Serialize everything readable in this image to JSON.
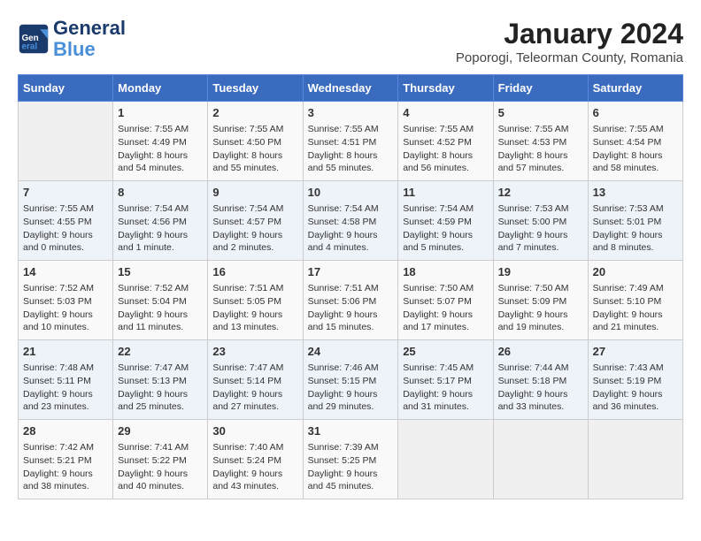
{
  "header": {
    "logo_line1": "General",
    "logo_line2": "Blue",
    "month_year": "January 2024",
    "location": "Poporogi, Teleorman County, Romania"
  },
  "days_of_week": [
    "Sunday",
    "Monday",
    "Tuesday",
    "Wednesday",
    "Thursday",
    "Friday",
    "Saturday"
  ],
  "weeks": [
    [
      {
        "day": "",
        "info": ""
      },
      {
        "day": "1",
        "info": "Sunrise: 7:55 AM\nSunset: 4:49 PM\nDaylight: 8 hours\nand 54 minutes."
      },
      {
        "day": "2",
        "info": "Sunrise: 7:55 AM\nSunset: 4:50 PM\nDaylight: 8 hours\nand 55 minutes."
      },
      {
        "day": "3",
        "info": "Sunrise: 7:55 AM\nSunset: 4:51 PM\nDaylight: 8 hours\nand 55 minutes."
      },
      {
        "day": "4",
        "info": "Sunrise: 7:55 AM\nSunset: 4:52 PM\nDaylight: 8 hours\nand 56 minutes."
      },
      {
        "day": "5",
        "info": "Sunrise: 7:55 AM\nSunset: 4:53 PM\nDaylight: 8 hours\nand 57 minutes."
      },
      {
        "day": "6",
        "info": "Sunrise: 7:55 AM\nSunset: 4:54 PM\nDaylight: 8 hours\nand 58 minutes."
      }
    ],
    [
      {
        "day": "7",
        "info": "Sunrise: 7:55 AM\nSunset: 4:55 PM\nDaylight: 9 hours\nand 0 minutes."
      },
      {
        "day": "8",
        "info": "Sunrise: 7:54 AM\nSunset: 4:56 PM\nDaylight: 9 hours\nand 1 minute."
      },
      {
        "day": "9",
        "info": "Sunrise: 7:54 AM\nSunset: 4:57 PM\nDaylight: 9 hours\nand 2 minutes."
      },
      {
        "day": "10",
        "info": "Sunrise: 7:54 AM\nSunset: 4:58 PM\nDaylight: 9 hours\nand 4 minutes."
      },
      {
        "day": "11",
        "info": "Sunrise: 7:54 AM\nSunset: 4:59 PM\nDaylight: 9 hours\nand 5 minutes."
      },
      {
        "day": "12",
        "info": "Sunrise: 7:53 AM\nSunset: 5:00 PM\nDaylight: 9 hours\nand 7 minutes."
      },
      {
        "day": "13",
        "info": "Sunrise: 7:53 AM\nSunset: 5:01 PM\nDaylight: 9 hours\nand 8 minutes."
      }
    ],
    [
      {
        "day": "14",
        "info": "Sunrise: 7:52 AM\nSunset: 5:03 PM\nDaylight: 9 hours\nand 10 minutes."
      },
      {
        "day": "15",
        "info": "Sunrise: 7:52 AM\nSunset: 5:04 PM\nDaylight: 9 hours\nand 11 minutes."
      },
      {
        "day": "16",
        "info": "Sunrise: 7:51 AM\nSunset: 5:05 PM\nDaylight: 9 hours\nand 13 minutes."
      },
      {
        "day": "17",
        "info": "Sunrise: 7:51 AM\nSunset: 5:06 PM\nDaylight: 9 hours\nand 15 minutes."
      },
      {
        "day": "18",
        "info": "Sunrise: 7:50 AM\nSunset: 5:07 PM\nDaylight: 9 hours\nand 17 minutes."
      },
      {
        "day": "19",
        "info": "Sunrise: 7:50 AM\nSunset: 5:09 PM\nDaylight: 9 hours\nand 19 minutes."
      },
      {
        "day": "20",
        "info": "Sunrise: 7:49 AM\nSunset: 5:10 PM\nDaylight: 9 hours\nand 21 minutes."
      }
    ],
    [
      {
        "day": "21",
        "info": "Sunrise: 7:48 AM\nSunset: 5:11 PM\nDaylight: 9 hours\nand 23 minutes."
      },
      {
        "day": "22",
        "info": "Sunrise: 7:47 AM\nSunset: 5:13 PM\nDaylight: 9 hours\nand 25 minutes."
      },
      {
        "day": "23",
        "info": "Sunrise: 7:47 AM\nSunset: 5:14 PM\nDaylight: 9 hours\nand 27 minutes."
      },
      {
        "day": "24",
        "info": "Sunrise: 7:46 AM\nSunset: 5:15 PM\nDaylight: 9 hours\nand 29 minutes."
      },
      {
        "day": "25",
        "info": "Sunrise: 7:45 AM\nSunset: 5:17 PM\nDaylight: 9 hours\nand 31 minutes."
      },
      {
        "day": "26",
        "info": "Sunrise: 7:44 AM\nSunset: 5:18 PM\nDaylight: 9 hours\nand 33 minutes."
      },
      {
        "day": "27",
        "info": "Sunrise: 7:43 AM\nSunset: 5:19 PM\nDaylight: 9 hours\nand 36 minutes."
      }
    ],
    [
      {
        "day": "28",
        "info": "Sunrise: 7:42 AM\nSunset: 5:21 PM\nDaylight: 9 hours\nand 38 minutes."
      },
      {
        "day": "29",
        "info": "Sunrise: 7:41 AM\nSunset: 5:22 PM\nDaylight: 9 hours\nand 40 minutes."
      },
      {
        "day": "30",
        "info": "Sunrise: 7:40 AM\nSunset: 5:24 PM\nDaylight: 9 hours\nand 43 minutes."
      },
      {
        "day": "31",
        "info": "Sunrise: 7:39 AM\nSunset: 5:25 PM\nDaylight: 9 hours\nand 45 minutes."
      },
      {
        "day": "",
        "info": ""
      },
      {
        "day": "",
        "info": ""
      },
      {
        "day": "",
        "info": ""
      }
    ]
  ]
}
